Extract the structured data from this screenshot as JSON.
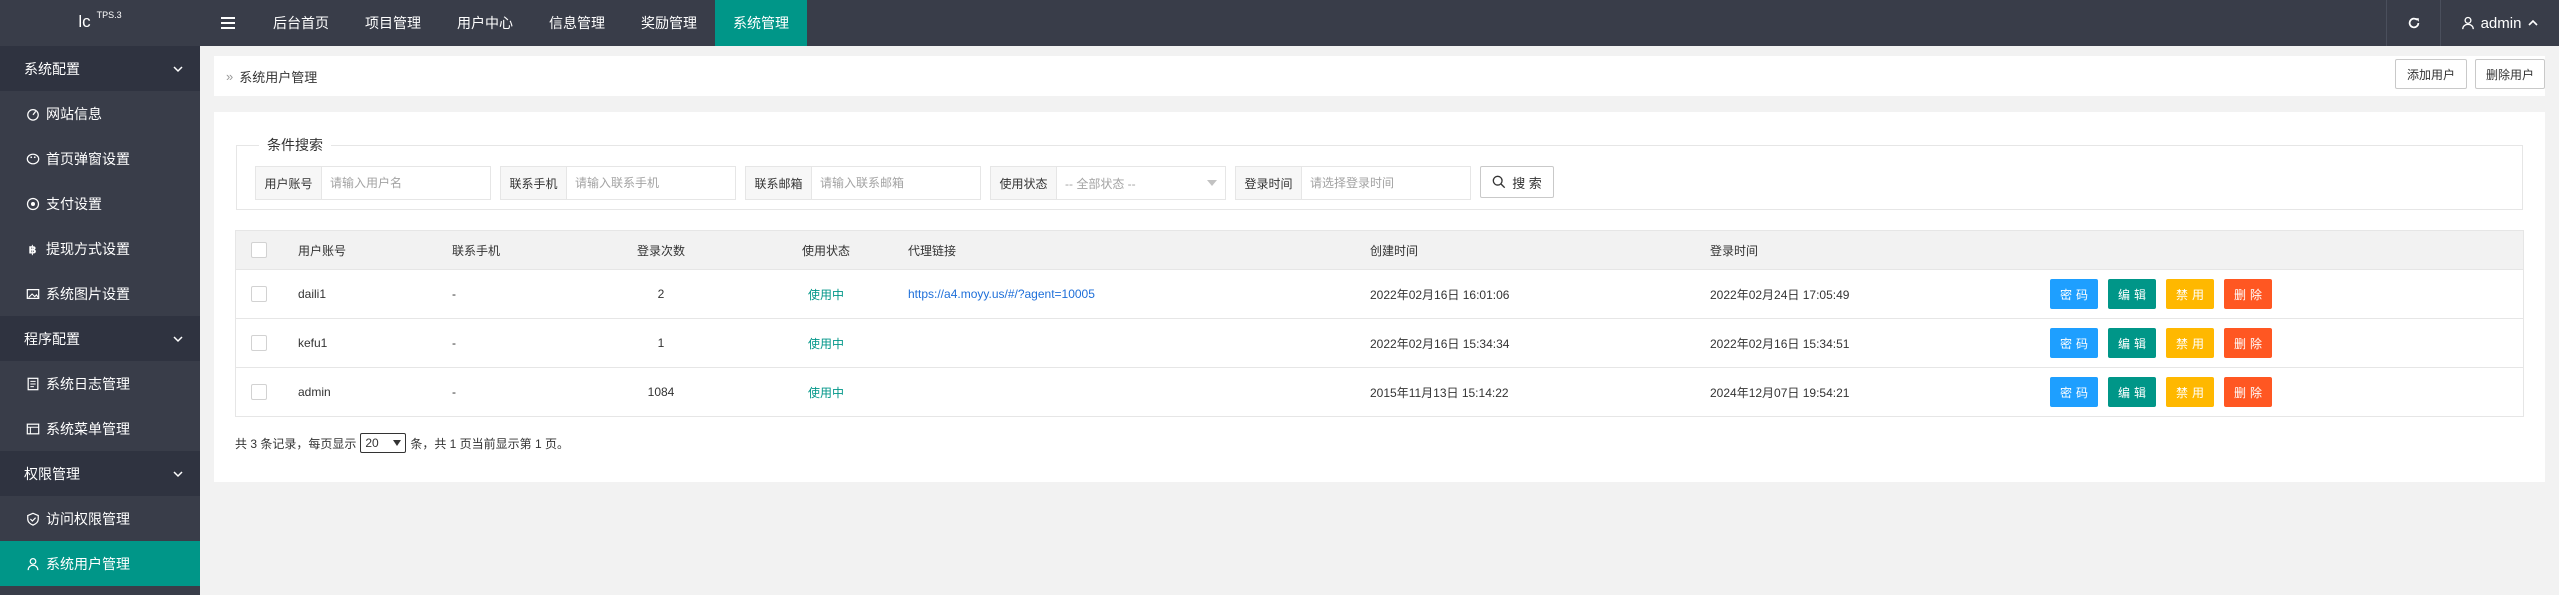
{
  "app": {
    "logo": "lc",
    "logo_sup": "TPS.3"
  },
  "topnav": {
    "items": [
      {
        "label": "后台首页",
        "active": false
      },
      {
        "label": "项目管理",
        "active": false
      },
      {
        "label": "用户中心",
        "active": false
      },
      {
        "label": "信息管理",
        "active": false
      },
      {
        "label": "奖励管理",
        "active": false
      },
      {
        "label": "系统管理",
        "active": true
      }
    ],
    "user": "admin"
  },
  "sidebar": {
    "groups": [
      {
        "label": "系统配置",
        "items": [
          {
            "label": "网站信息",
            "icon": "dashboard-icon"
          },
          {
            "label": "首页弹窗设置",
            "icon": "palette-icon"
          },
          {
            "label": "支付设置",
            "icon": "settings-icon"
          },
          {
            "label": "提现方式设置",
            "icon": "bitcoin-icon"
          },
          {
            "label": "系统图片设置",
            "icon": "image-icon"
          }
        ]
      },
      {
        "label": "程序配置",
        "items": [
          {
            "label": "系统日志管理",
            "icon": "log-icon"
          },
          {
            "label": "系统菜单管理",
            "icon": "menu-icon"
          }
        ]
      },
      {
        "label": "权限管理",
        "items": [
          {
            "label": "访问权限管理",
            "icon": "shield-check-icon"
          },
          {
            "label": "系统用户管理",
            "icon": "user-icon",
            "active": true
          }
        ]
      }
    ]
  },
  "breadcrumb": {
    "title": "系统用户管理"
  },
  "header_buttons": {
    "add": "添加用户",
    "delete": "删除用户"
  },
  "search": {
    "legend": "条件搜索",
    "username": {
      "label": "用户账号",
      "placeholder": "请输入用户名"
    },
    "phone": {
      "label": "联系手机",
      "placeholder": "请输入联系手机"
    },
    "email": {
      "label": "联系邮箱",
      "placeholder": "请输入联系邮箱"
    },
    "status": {
      "label": "使用状态",
      "value": "-- 全部状态 --"
    },
    "login_time": {
      "label": "登录时间",
      "placeholder": "请选择登录时间"
    },
    "button": "搜 索"
  },
  "table": {
    "columns": [
      "用户账号",
      "联系手机",
      "登录次数",
      "使用状态",
      "代理链接",
      "创建时间",
      "登录时间"
    ],
    "rows": [
      {
        "username": "daili1",
        "phone": "-",
        "logins": "2",
        "status": "使用中",
        "link": "https://a4.moyy.us/#/?agent=10005",
        "created": "2022年02月16日 16:01:06",
        "login_time": "2022年02月24日 17:05:49"
      },
      {
        "username": "kefu1",
        "phone": "-",
        "logins": "1",
        "status": "使用中",
        "link": "",
        "created": "2022年02月16日 15:34:34",
        "login_time": "2022年02月16日 15:34:51"
      },
      {
        "username": "admin",
        "phone": "-",
        "logins": "1084",
        "status": "使用中",
        "link": "",
        "created": "2015年11月13日 15:14:22",
        "login_time": "2024年12月07日 19:54:21"
      }
    ],
    "actions": {
      "password": "密码",
      "edit": "编辑",
      "disable": "禁用",
      "delete": "删除"
    }
  },
  "pager": {
    "prefix": "共 3 条记录，每页显示",
    "page_size": "20",
    "suffix": "条，共 1 页当前显示第 1 页。"
  },
  "colors": {
    "topbar": "#393d49",
    "accent": "#009688",
    "blue": "#1e9fff",
    "yellow": "#ffb800",
    "red": "#ff5722"
  }
}
